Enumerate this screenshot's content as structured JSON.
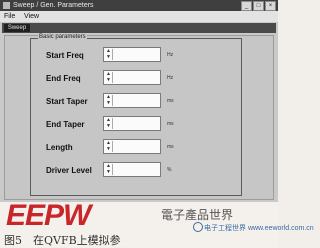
{
  "window": {
    "title": "Sweep / Gen. Parameters",
    "minimize_glyph": "_",
    "maximize_glyph": "□",
    "close_glyph": "×"
  },
  "menubar": {
    "file": "File",
    "view": "View"
  },
  "tabs": [
    {
      "label": "Sweep"
    }
  ],
  "group": {
    "title": "Basic parameters",
    "rows": [
      {
        "label": "Start Freq",
        "value": "",
        "unit": "Hz"
      },
      {
        "label": "End Freq",
        "value": "",
        "unit": "Hz"
      },
      {
        "label": "Start Taper",
        "value": "",
        "unit": "ms"
      },
      {
        "label": "End Taper",
        "value": "",
        "unit": "ms"
      },
      {
        "label": "Length",
        "value": "",
        "unit": "ms"
      },
      {
        "label": "Driver Level",
        "value": "",
        "unit": "%"
      }
    ]
  },
  "spin": {
    "up": "▲",
    "down": "▼"
  },
  "overlay": {
    "logo": "EEPW",
    "brand_cn": "電子產品世界",
    "watermark": "电子工程世界 www.eeworld.com.cn",
    "caption": "图5　在QVFB上模拟参"
  },
  "colors": {
    "logo": "#c8262a",
    "titlebar": "#3f3f3f",
    "panel": "#c6c6c6"
  }
}
